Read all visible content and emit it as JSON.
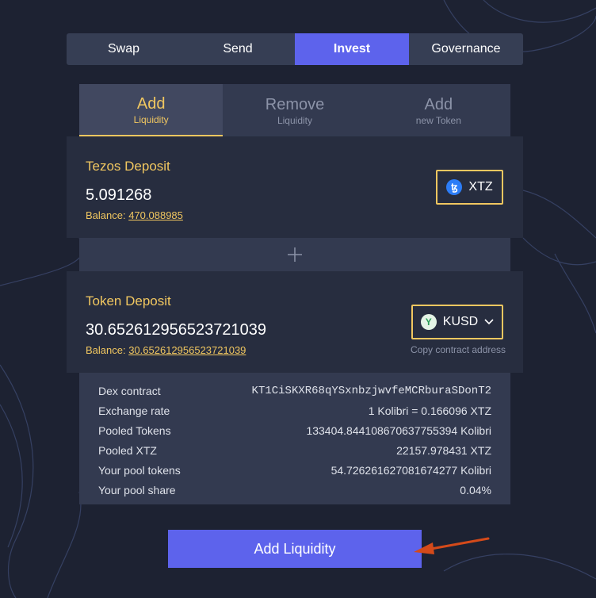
{
  "nav": {
    "tabs": [
      {
        "label": "Swap"
      },
      {
        "label": "Send"
      },
      {
        "label": "Invest"
      },
      {
        "label": "Governance"
      }
    ]
  },
  "subtabs": [
    {
      "main": "Add",
      "sub": "Liquidity"
    },
    {
      "main": "Remove",
      "sub": "Liquidity"
    },
    {
      "main": "Add",
      "sub": "new Token"
    }
  ],
  "tezos": {
    "title": "Tezos Deposit",
    "amount": "5.091268",
    "balance_label": "Balance: ",
    "balance_value": "470.088985",
    "token": "XTZ",
    "token_icon": "tezos-icon"
  },
  "plus": {
    "icon": "plus-icon"
  },
  "token_deposit": {
    "title": "Token Deposit",
    "amount": "30.652612956523721039",
    "balance_label": "Balance: ",
    "balance_value": "30.652612956523721039",
    "token": "KUSD",
    "token_icon": "kolibri-icon",
    "copy_label": "Copy contract address"
  },
  "info": {
    "rows": [
      {
        "label": "Dex contract",
        "value": "KT1CiSKXR68qYSxnbzjwvfeMCRburaSDonT2"
      },
      {
        "label": "Exchange rate",
        "value": "1 Kolibri = 0.166096 XTZ"
      },
      {
        "label": "Pooled Tokens",
        "value": "133404.844108670637755394 Kolibri"
      },
      {
        "label": "Pooled XTZ",
        "value": "22157.978431 XTZ"
      },
      {
        "label": "Your pool tokens",
        "value": "54.726261627081674277 Kolibri"
      },
      {
        "label": "Your pool share",
        "value": "0.04%"
      }
    ]
  },
  "action": {
    "label": "Add Liquidity"
  },
  "colors": {
    "accent": "#5d63ec",
    "gold": "#f1c760",
    "background": "#1d2232",
    "arrow": "#d44a1a"
  }
}
